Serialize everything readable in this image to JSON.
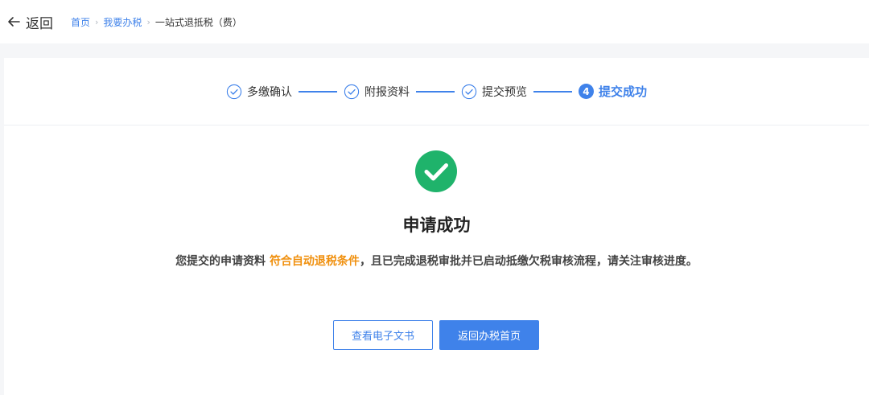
{
  "header": {
    "back_label": "返回",
    "breadcrumb": {
      "home": "首页",
      "sep": "›",
      "section": "我要办税",
      "current": "一站式退抵税（费）"
    }
  },
  "steps": [
    {
      "label": "多缴确认",
      "state": "done"
    },
    {
      "label": "附报资料",
      "state": "done"
    },
    {
      "label": "提交预览",
      "state": "done"
    },
    {
      "label": "提交成功",
      "state": "active",
      "number": "4"
    }
  ],
  "result": {
    "title": "申请成功",
    "message_prefix": "您提交的申请资料",
    "message_highlight": "符合自动退税条件",
    "message_suffix": "，且已完成退税审批并已启动抵缴欠税审核流程，请关注审核进度。"
  },
  "actions": {
    "view_doc": "查看电子文书",
    "back_home": "返回办税首页"
  },
  "colors": {
    "accent": "#3f82ea",
    "success": "#1fb36b",
    "highlight": "#f0900e"
  }
}
